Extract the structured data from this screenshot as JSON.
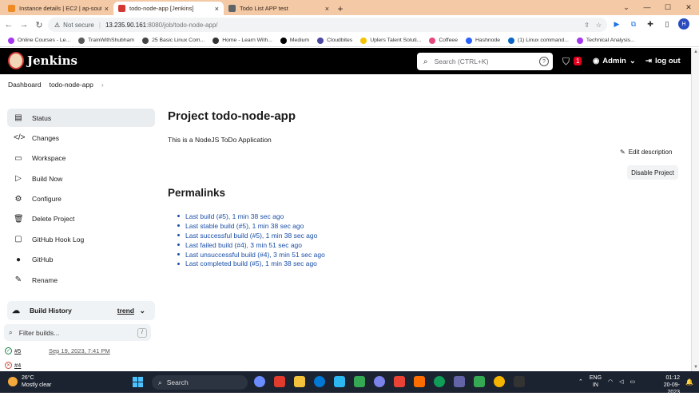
{
  "browser": {
    "tabs": [
      {
        "title": "Instance details | EC2 | ap-south",
        "icon_color": "#f08a24",
        "active": false
      },
      {
        "title": "todo-node-app [Jenkins]",
        "icon_color": "#d33833",
        "active": true
      },
      {
        "title": "Todo List APP test",
        "icon_color": "#5f6368",
        "active": false
      }
    ],
    "new_tab": "+",
    "window_controls": [
      "⌄",
      "—",
      "☐",
      "✕"
    ],
    "address": {
      "security": "Not secure",
      "separator": "|",
      "host": "13.235.90.161",
      "path": ":8080/job/todo-node-app/"
    },
    "profile_initial": "H",
    "bookmarks": [
      {
        "label": "Online Courses - Le...",
        "color": "#a435f0"
      },
      {
        "label": "TrainWithShubham",
        "color": "#5a5a5a"
      },
      {
        "label": "25 Basic Linux Com...",
        "color": "#444"
      },
      {
        "label": "Home - Learn With...",
        "color": "#333"
      },
      {
        "label": "Medium",
        "color": "#000"
      },
      {
        "label": "Cloudbites",
        "color": "#4a47a3"
      },
      {
        "label": "Uplers Talent Soluti...",
        "color": "#f5c400"
      },
      {
        "label": "Coffeee",
        "color": "#e5487a"
      },
      {
        "label": "Hashnode",
        "color": "#2962ff"
      },
      {
        "label": "(1) Linux command...",
        "color": "#0a66c2"
      },
      {
        "label": "Technical Analysis...",
        "color": "#a435f0"
      }
    ]
  },
  "jenkins": {
    "brand": "Jenkins",
    "search_placeholder": "Search (CTRL+K)",
    "help": "?",
    "alert_count": "1",
    "user": "Admin",
    "logout": "log out",
    "breadcrumbs": [
      "Dashboard",
      "todo-node-app"
    ],
    "sidebar": [
      {
        "label": "Status",
        "icon": "document-icon",
        "glyph": "▤",
        "active": true
      },
      {
        "label": "Changes",
        "icon": "code-icon",
        "glyph": "</>",
        "active": false
      },
      {
        "label": "Workspace",
        "icon": "folder-icon",
        "glyph": "▭",
        "active": false
      },
      {
        "label": "Build Now",
        "icon": "play-icon",
        "glyph": "▷",
        "active": false
      },
      {
        "label": "Configure",
        "icon": "gear-icon",
        "glyph": "⚙",
        "active": false
      },
      {
        "label": "Delete Project",
        "icon": "trash-icon",
        "glyph": "🗑",
        "active": false
      },
      {
        "label": "GitHub Hook Log",
        "icon": "log-icon",
        "glyph": "▢",
        "active": false
      },
      {
        "label": "GitHub",
        "icon": "github-icon",
        "glyph": "●",
        "active": false
      },
      {
        "label": "Rename",
        "icon": "pencil-icon",
        "glyph": "✎",
        "active": false
      }
    ],
    "build_history": {
      "title": "Build History",
      "trend": "trend",
      "filter_placeholder": "Filter builds...",
      "filter_shortcut": "/",
      "builds": [
        {
          "number": "#5",
          "date": "Sep 19, 2023, 7:41 PM",
          "status": "success",
          "color": "#138347",
          "glyph": "✓"
        },
        {
          "number": "#4",
          "date": "",
          "status": "failed",
          "color": "#d24939",
          "glyph": "✕"
        }
      ]
    },
    "project": {
      "title": "Project todo-node-app",
      "description": "This is a NodeJS ToDo Application",
      "edit_description": "Edit description",
      "disable_button": "Disable Project",
      "permalinks_heading": "Permalinks",
      "permalinks": [
        "Last build (#5), 1 min 38 sec ago",
        "Last stable build (#5), 1 min 38 sec ago",
        "Last successful build (#5), 1 min 38 sec ago",
        "Last failed build (#4), 3 min 51 sec ago",
        "Last unsuccessful build (#4), 3 min 51 sec ago",
        "Last completed build (#5), 1 min 38 sec ago"
      ]
    }
  },
  "taskbar": {
    "temperature": "26°C",
    "weather": "Mostly clear",
    "search": "Search",
    "language_line1": "ENG",
    "language_line2": "IN",
    "time": "01:12",
    "date": "20-09-2023",
    "apps": [
      "#6b8cff",
      "#e03b2d",
      "#f3c23c",
      "#0078d4",
      "#2cb7f0",
      "#34a853",
      "#7b83eb",
      "#ea4335",
      "#ff6d00",
      "#0f9d58",
      "#6264a7",
      "#34a853",
      "#f4b400",
      "#333"
    ]
  }
}
